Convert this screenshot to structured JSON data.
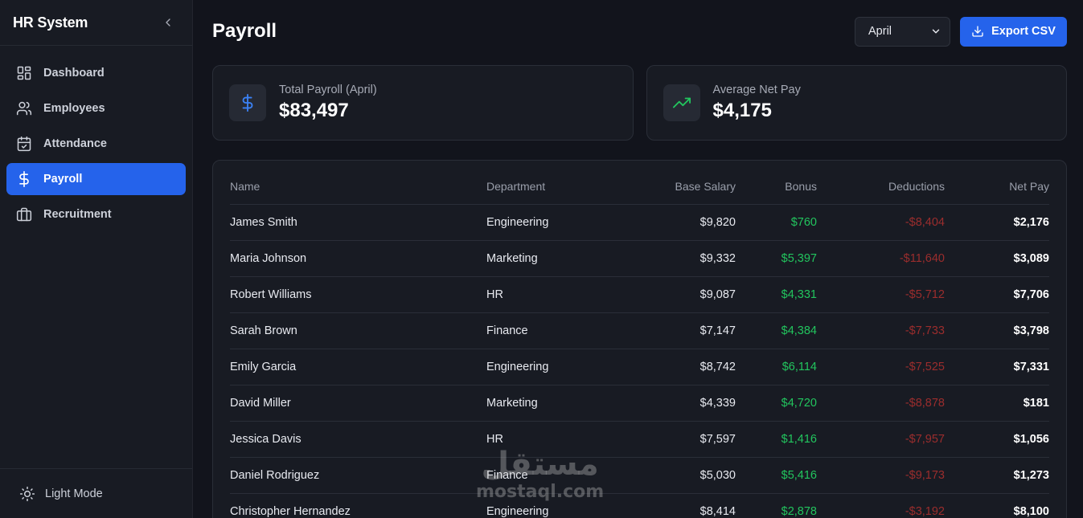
{
  "sidebar": {
    "brand": "HR System",
    "items": [
      {
        "label": "Dashboard",
        "icon": "dashboard-icon"
      },
      {
        "label": "Employees",
        "icon": "users-icon"
      },
      {
        "label": "Attendance",
        "icon": "calendar-check-icon"
      },
      {
        "label": "Payroll",
        "icon": "dollar-icon",
        "active": true
      },
      {
        "label": "Recruitment",
        "icon": "briefcase-icon"
      }
    ],
    "footer_label": "Light Mode"
  },
  "header": {
    "title": "Payroll",
    "month_selected": "April",
    "export_label": "Export CSV"
  },
  "cards": {
    "total_label": "Total Payroll (April)",
    "total_value": "$83,497",
    "avg_label": "Average Net Pay",
    "avg_value": "$4,175"
  },
  "table": {
    "headers": [
      "Name",
      "Department",
      "Base Salary",
      "Bonus",
      "Deductions",
      "Net Pay"
    ],
    "rows": [
      [
        "James Smith",
        "Engineering",
        "$9,820",
        "$760",
        "-$8,404",
        "$2,176"
      ],
      [
        "Maria Johnson",
        "Marketing",
        "$9,332",
        "$5,397",
        "-$11,640",
        "$3,089"
      ],
      [
        "Robert Williams",
        "HR",
        "$9,087",
        "$4,331",
        "-$5,712",
        "$7,706"
      ],
      [
        "Sarah Brown",
        "Finance",
        "$7,147",
        "$4,384",
        "-$7,733",
        "$3,798"
      ],
      [
        "Emily Garcia",
        "Engineering",
        "$8,742",
        "$6,114",
        "-$7,525",
        "$7,331"
      ],
      [
        "David Miller",
        "Marketing",
        "$4,339",
        "$4,720",
        "-$8,878",
        "$181"
      ],
      [
        "Jessica Davis",
        "HR",
        "$7,597",
        "$1,416",
        "-$7,957",
        "$1,056"
      ],
      [
        "Daniel Rodriguez",
        "Finance",
        "$5,030",
        "$5,416",
        "-$9,173",
        "$1,273"
      ],
      [
        "Christopher Hernandez",
        "Engineering",
        "$8,414",
        "$2,878",
        "-$3,192",
        "$8,100"
      ]
    ]
  },
  "watermark": {
    "arabic": "مستقل",
    "latin": "mostaql.com"
  },
  "colors": {
    "accent": "#2563eb",
    "bonus": "#22c55e",
    "deduction": "#9b2d2d",
    "background": "#12141c",
    "surface": "#181b23"
  }
}
